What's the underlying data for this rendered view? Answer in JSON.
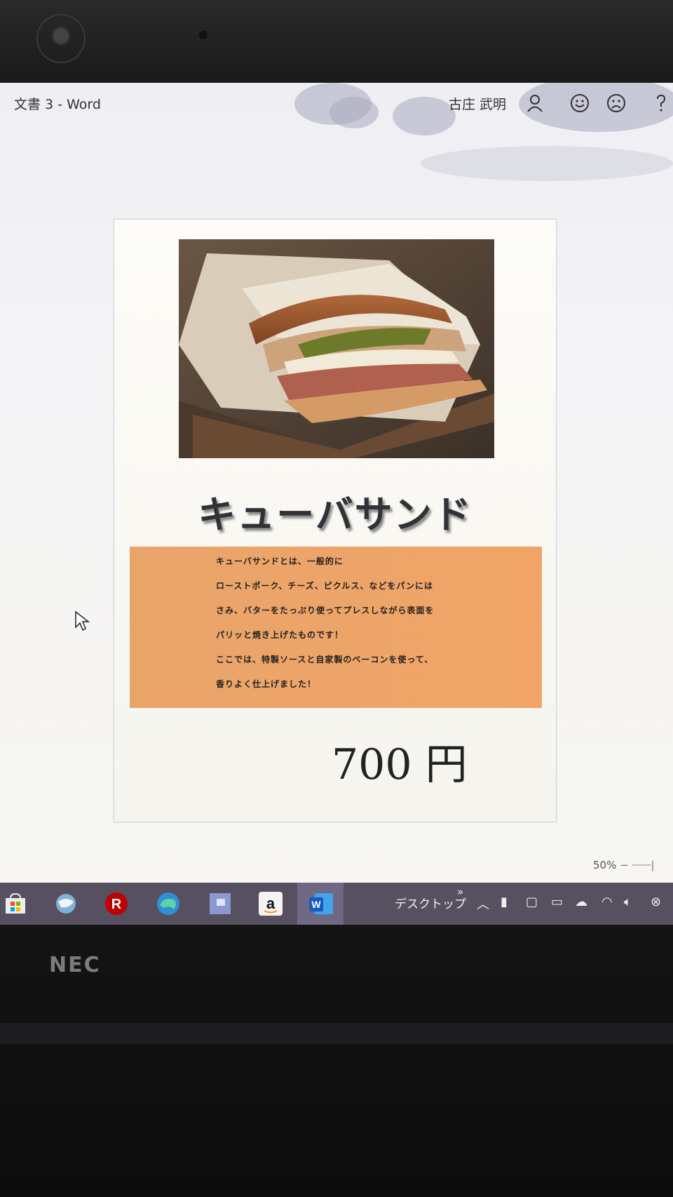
{
  "window": {
    "title": "文書 3 - Word",
    "user_name": "古庄 武明"
  },
  "document": {
    "headline": "キューバサンド",
    "description_lines": [
      "キューバサンドとは、一般的に",
      "ローストポーク、チーズ、ピクルス、などをパンには",
      "さみ、バターをたっぷり使ってプレスしながら表面を",
      "パリッと焼き上げたものです！",
      "ここでは、特製ソースと自家製のベーコンを使って、",
      "香りよく仕上げました！"
    ],
    "price": "700 円",
    "image_subject": "cuban-sandwich-photo"
  },
  "status": {
    "zoom": "50%"
  },
  "taskbar": {
    "apps": [
      "store-icon",
      "browser-icon",
      "rakuten-icon",
      "edge-icon",
      "app-icon",
      "amazon-icon",
      "word-icon"
    ],
    "desktop_label": "デスクトップ",
    "overflow": "»"
  },
  "hardware": {
    "brand": "NEC"
  },
  "colors": {
    "description_box": "#efa466",
    "taskbar": "#565061"
  }
}
